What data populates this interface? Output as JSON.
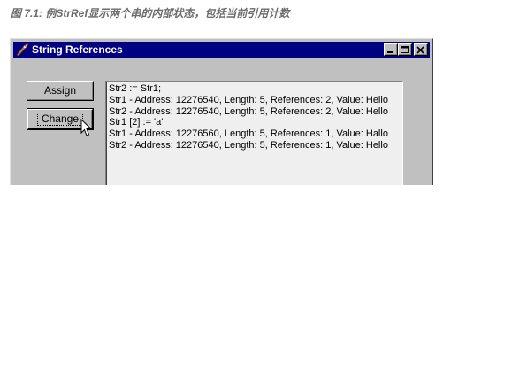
{
  "caption": "图 7.1: 例StrRef显示两个串的内部状态，包括当前引用计数",
  "window": {
    "title": "String References",
    "icon": "torch-icon",
    "controls": [
      "minimize",
      "maximize",
      "close"
    ]
  },
  "buttons": {
    "assign_label": "Assign",
    "change_label": "Change"
  },
  "log": {
    "lines": [
      "Str2 := Str1;",
      "Str1 - Address: 12276540, Length: 5, References: 2, Value: Hello",
      "Str2 - Address: 12276540, Length: 5, References: 2, Value: Hello",
      "Str1 [2] := 'a'",
      "Str1 - Address: 12276560, Length: 5, References: 1, Value: Hallo",
      "Str2 - Address: 12276540, Length: 5, References: 1, Value: Hello"
    ]
  },
  "colors": {
    "titlebar": "#000080",
    "window_face": "#c0c0c0",
    "log_background": "#efefef",
    "caption_text": "#6b6b6b"
  }
}
